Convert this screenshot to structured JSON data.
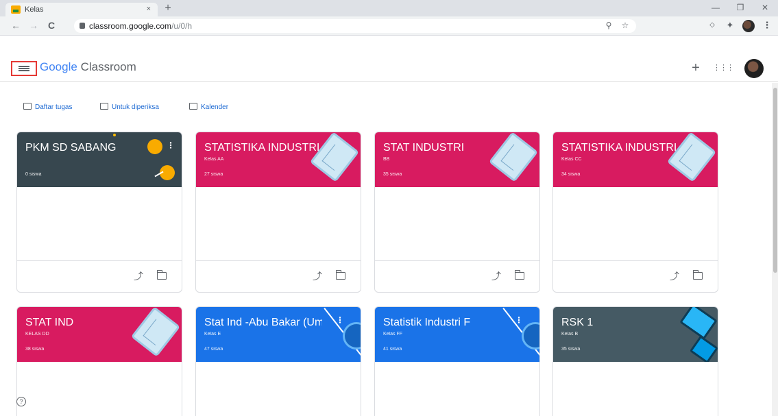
{
  "browser": {
    "tab_title": "Kelas",
    "tab_close": "×",
    "new_tab": "+",
    "window_minimize": "—",
    "window_maximize": "❐",
    "window_close": "✕",
    "url_host": "classroom.google.com",
    "url_path": "/u/0/h",
    "back": "←",
    "forward": "→",
    "reload": "C"
  },
  "header": {
    "brand_google": "Google",
    "brand_product": "Classroom",
    "add_label": "+",
    "apps_label": "⋮⋮⋮"
  },
  "quick_links": [
    {
      "label": "Daftar tugas"
    },
    {
      "label": "Untuk diperiksa"
    },
    {
      "label": "Kalender"
    }
  ],
  "courses": [
    {
      "name": "PKM SD SABANG",
      "section": "",
      "students": "0 siswa",
      "color": "#37474f"
    },
    {
      "name": "STATISTIKA INDUSTRI",
      "section": "Kelas AA",
      "students": "27 siswa",
      "color": "#d81b60"
    },
    {
      "name": "STAT INDUSTRI",
      "section": "BB",
      "students": "35 siswa",
      "color": "#d81b60"
    },
    {
      "name": "STATISTIKA INDUSTRI",
      "section": "Kelas CC",
      "students": "34 siswa",
      "color": "#d81b60"
    },
    {
      "name": "STAT IND",
      "section": "KELAS DD",
      "students": "38 siswa",
      "color": "#d81b60"
    },
    {
      "name": "Stat Ind -Abu Bakar (Ums)",
      "section": "Kelas E",
      "students": "47 siswa",
      "color": "#1a73e8"
    },
    {
      "name": "Statistik Industri F",
      "section": "Kelas FF",
      "students": "41 siswa",
      "color": "#1a73e8"
    },
    {
      "name": "RSK 1",
      "section": "Kelas B",
      "students": "35 siswa",
      "color": "#455a64"
    }
  ],
  "card_icons": {
    "trend": "trending-up-icon",
    "folder": "folder-icon",
    "more": "⋮"
  },
  "help_label": "?"
}
